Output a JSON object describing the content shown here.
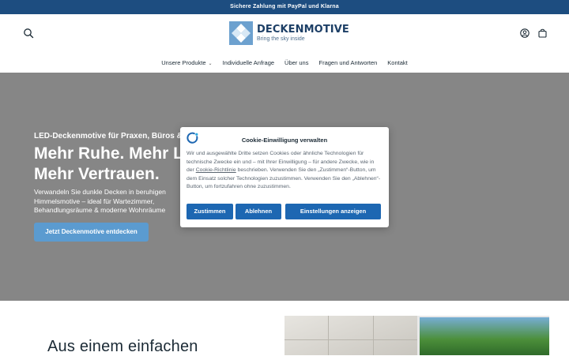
{
  "topbar": {
    "text": "Sichere Zahlung mit PayPal und Klarna"
  },
  "header": {
    "logo_name": "DECKENMOTIVE",
    "logo_tagline": "Bring the sky inside"
  },
  "nav": {
    "items": [
      {
        "label": "Unsere Produkte",
        "has_dropdown": true
      },
      {
        "label": "Individuelle Anfrage"
      },
      {
        "label": "Über uns"
      },
      {
        "label": "Fragen und Antworten"
      },
      {
        "label": "Kontakt"
      }
    ]
  },
  "hero": {
    "subtitle": "LED-Deckenmotive für Praxen, Büros &",
    "title_line1": "Mehr Ruhe. Mehr L",
    "title_line2": "Mehr Vertrauen.",
    "body_line1": "Verwandeln Sie dunkle Decken in beruhigen",
    "body_line2": "Himmelsmotive – ideal für Wartezimmer,",
    "body_line3": "Behandlungsräume & moderne Wohnräume",
    "cta": "Jetzt Deckenmotive entdecken"
  },
  "section": {
    "title": "Aus einem einfachen"
  },
  "cookie": {
    "title": "Cookie-Einwilligung verwalten",
    "text_before_link": "Wir und ausgewählte Dritte setzen Cookies oder ähnliche Technologien für technische Zwecke ein und – mit Ihrer Einwilligung – für andere Zwecke, wie in der ",
    "link": "Cookie-Richtlinie",
    "text_after_link": " beschrieben. Verwenden Sie den „Zustimmen“-Button, um dem Einsatz solcher Technologien zuzustimmen. Verwenden Sie den „Ablehnen“-Button, um fortzufahren ohne zuzustimmen.",
    "accept": "Zustimmen",
    "decline": "Ablehnen",
    "settings": "Einstellungen anzeigen"
  },
  "colors": {
    "topbar": "#1d4d80",
    "hero_bg": "#868686",
    "cta": "#5b9bd0",
    "cookie_button": "#1d67b2"
  }
}
